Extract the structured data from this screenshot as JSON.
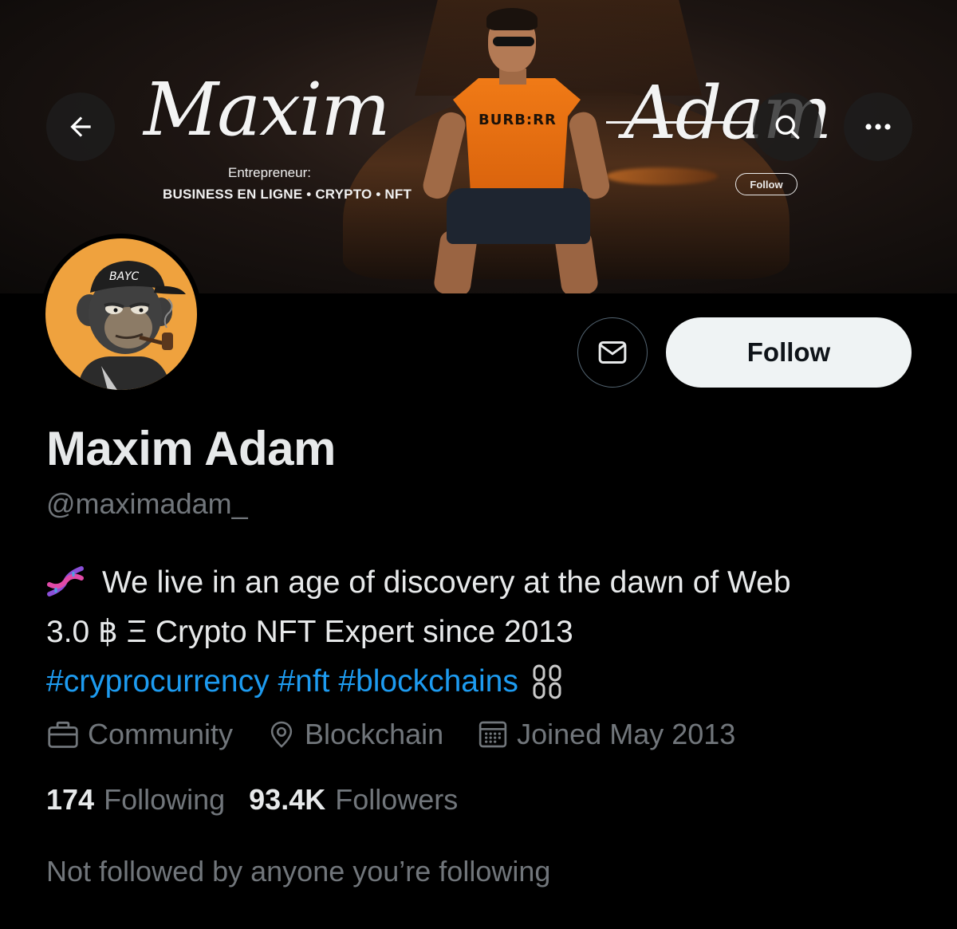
{
  "banner": {
    "first_name_script": "Maxim",
    "last_name_script": "Adam",
    "subtitle": "Entrepreneur:",
    "tagline": "BUSINESS EN LIGNE • CRYPTO • NFT",
    "shirt_text": "BURB:RR",
    "follow_label": "Follow"
  },
  "nav": {
    "back_icon": "arrow-left-icon",
    "search_icon": "search-icon",
    "more_icon": "more-horizontal-icon"
  },
  "avatar": {
    "cap_text": "BAYC"
  },
  "actions": {
    "message_icon": "envelope-icon",
    "follow_label": "Follow"
  },
  "profile": {
    "display_name": "Maxim Adam",
    "handle": "@maximadam_",
    "bio_line1": "We live in an age of discovery at the dawn of Web",
    "bio_line2": "3.0 ฿ Ξ Crypto NFT Expert since 2013",
    "hashtags": [
      "#cryprocurrency",
      "#nft",
      "#blockchains"
    ],
    "meta": {
      "category": "Community",
      "location": "Blockchain",
      "joined": "Joined May 2013"
    },
    "stats": {
      "following_count": "174",
      "following_label": "Following",
      "followers_count": "93.4K",
      "followers_label": "Followers"
    },
    "mutuals_text": "Not followed by anyone you’re following"
  },
  "colors": {
    "background": "#000000",
    "text_primary": "#e7e9ea",
    "text_secondary": "#71767b",
    "link": "#1d9bf0",
    "follow_button_bg": "#eff3f4",
    "avatar_bg": "#efa23e"
  }
}
